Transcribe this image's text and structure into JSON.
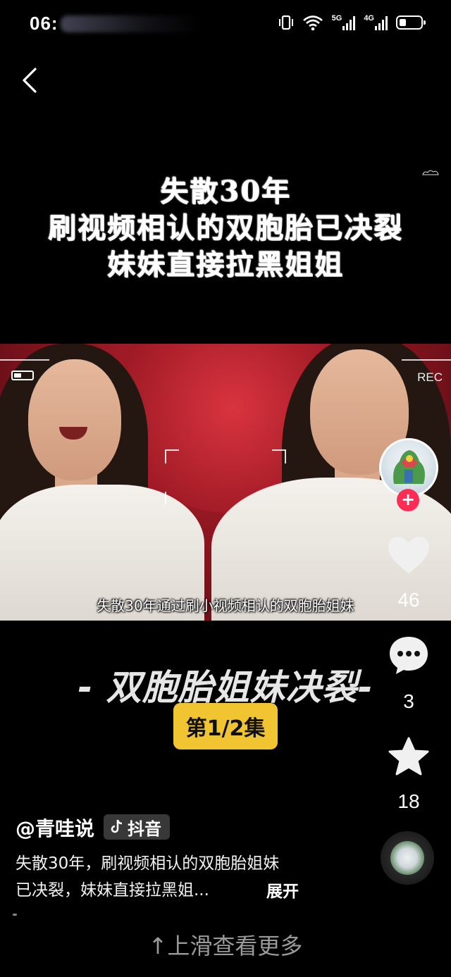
{
  "status_bar": {
    "time": "06:",
    "network_5g": "5G",
    "network_4g": "4G"
  },
  "headline": {
    "line1": "失散30年",
    "line2": "刷视频相认的双胞胎已决裂",
    "line3": "妹妹直接拉黑姐姐"
  },
  "video": {
    "rec_label": "REC",
    "subtitle": "失散30年通过刷小视频相认的双胞胎姐妹"
  },
  "rail": {
    "likes": "46",
    "comments": "3",
    "favorites": "18",
    "follow_symbol": "+"
  },
  "series": {
    "title": "- 双胞胎姐妹决裂-",
    "episode": "第1/2集"
  },
  "author": {
    "handle": "@青哇说",
    "platform": "抖音"
  },
  "caption": {
    "line1": "失散30年，刷视频相认的双胞胎姐妹",
    "line2": "已决裂，妹妹直接拉黑姐...",
    "expand": "展开"
  },
  "swipe_hint": "↑上滑查看更多",
  "colors": {
    "follow": "#fe2c55",
    "episode_badge": "#f1c431",
    "background": "#000000"
  },
  "icons": [
    "back-icon",
    "vibrate-icon",
    "wifi-icon",
    "signal-icon",
    "battery-icon",
    "heart-icon",
    "comment-icon",
    "star-icon",
    "music-disc-icon",
    "tiktok-icon"
  ]
}
